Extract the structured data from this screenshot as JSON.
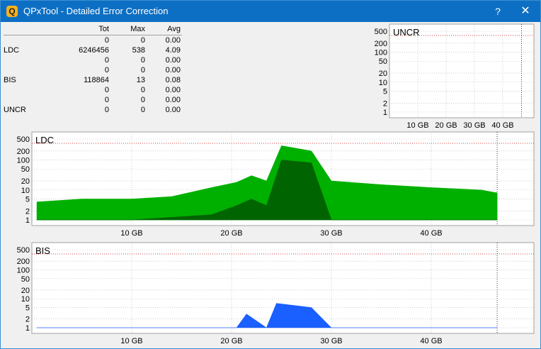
{
  "window": {
    "title": "QPxTool - Detailed Error Correction",
    "icon_letter": "Q",
    "help_symbol": "?",
    "close_symbol": "✕"
  },
  "stats": {
    "headers": {
      "tot": "Tot",
      "max": "Max",
      "avg": "Avg"
    },
    "rows": [
      {
        "label": "",
        "tot": "0",
        "max": "0",
        "avg": "0.00"
      },
      {
        "label": "LDC",
        "tot": "6246456",
        "max": "538",
        "avg": "4.09"
      },
      {
        "label": "",
        "tot": "0",
        "max": "0",
        "avg": "0.00"
      },
      {
        "label": "",
        "tot": "0",
        "max": "0",
        "avg": "0.00"
      },
      {
        "label": "BIS",
        "tot": "118864",
        "max": "13",
        "avg": "0.08"
      },
      {
        "label": "",
        "tot": "0",
        "max": "0",
        "avg": "0.00"
      },
      {
        "label": "",
        "tot": "0",
        "max": "0",
        "avg": "0.00"
      },
      {
        "label": "UNCR",
        "tot": "0",
        "max": "0",
        "avg": "0.00"
      }
    ]
  },
  "chart_data": [
    {
      "id": "uncr",
      "type": "area",
      "title": "UNCR",
      "y_scale": "log",
      "yticks": [
        "500",
        "200",
        "100",
        "50",
        "20",
        "10",
        "5",
        "2",
        "1"
      ],
      "xticks": [
        "10 GB",
        "20 GB",
        "30 GB",
        "40 GB"
      ],
      "xlim_gb": [
        0,
        50
      ],
      "series": [],
      "colors": {
        "grid": "#b0b0b0",
        "limit_line": "#c00000"
      }
    },
    {
      "id": "ldc",
      "type": "area",
      "title": "LDC",
      "y_scale": "log",
      "yticks": [
        "500",
        "200",
        "100",
        "50",
        "20",
        "10",
        "5",
        "2",
        "1"
      ],
      "xticks": [
        "10 GB",
        "20 GB",
        "30 GB",
        "40 GB"
      ],
      "xlim_gb": [
        0,
        50
      ],
      "colors": {
        "primary": "#00b000",
        "secondary": "#006400",
        "grid": "#b0b0b0",
        "limit_line": "#c00000"
      },
      "series": [
        {
          "x_gb": [
            0.5,
            5,
            10,
            14,
            18,
            20.5,
            22,
            23.5,
            25,
            28,
            30,
            35,
            40,
            45,
            46.6
          ],
          "values": [
            4,
            5,
            5,
            6,
            12,
            18,
            30,
            20,
            300,
            200,
            20,
            15,
            12,
            10,
            8
          ]
        },
        {
          "x_gb": [
            0.5,
            10,
            18,
            20.5,
            22,
            23.5,
            25,
            28,
            30,
            40,
            46.6
          ],
          "values": [
            1,
            1,
            1.5,
            3,
            5,
            3,
            100,
            80,
            1,
            1,
            1
          ]
        }
      ]
    },
    {
      "id": "bis",
      "type": "area",
      "title": "BIS",
      "y_scale": "log",
      "yticks": [
        "500",
        "200",
        "100",
        "50",
        "20",
        "10",
        "5",
        "2",
        "1"
      ],
      "xticks": [
        "10 GB",
        "20 GB",
        "30 GB",
        "40 GB"
      ],
      "xlim_gb": [
        0,
        50
      ],
      "colors": {
        "primary": "#1a5fff",
        "secondary": "#0a2c8c",
        "grid": "#b0b0b0",
        "limit_line": "#c00000"
      },
      "series": [
        {
          "x_gb": [
            0.5,
            20.5,
            21.5,
            23.5,
            24.5,
            28,
            30,
            46.6
          ],
          "values": [
            1,
            1,
            3,
            1,
            7,
            5,
            1,
            1
          ]
        }
      ]
    }
  ]
}
